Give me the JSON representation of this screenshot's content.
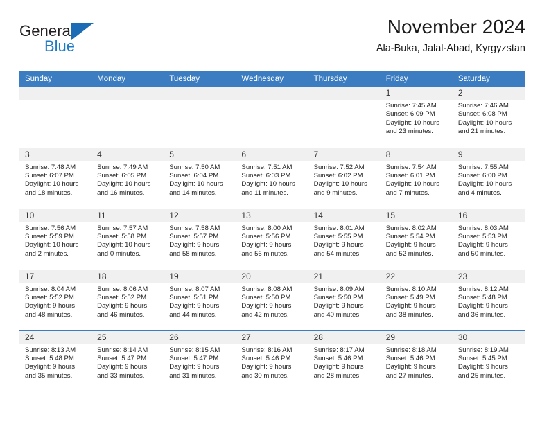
{
  "brand": {
    "name_part1": "General",
    "name_part2": "Blue",
    "logo_icon": "blue-triangle-logo",
    "accent_color": "#1b6cb5"
  },
  "header": {
    "month_title": "November 2024",
    "location": "Ala-Buka, Jalal-Abad, Kyrgyzstan"
  },
  "calendar": {
    "header_color": "#3b7dc0",
    "daynum_band_color": "#f0f0f0",
    "weekday_headers": [
      "Sunday",
      "Monday",
      "Tuesday",
      "Wednesday",
      "Thursday",
      "Friday",
      "Saturday"
    ],
    "weeks": [
      [
        {
          "day": "",
          "blank": true
        },
        {
          "day": "",
          "blank": true
        },
        {
          "day": "",
          "blank": true
        },
        {
          "day": "",
          "blank": true
        },
        {
          "day": "",
          "blank": true
        },
        {
          "day": "1",
          "sunrise": "Sunrise: 7:45 AM",
          "sunset": "Sunset: 6:09 PM",
          "daylight_line1": "Daylight: 10 hours",
          "daylight_line2": "and 23 minutes."
        },
        {
          "day": "2",
          "sunrise": "Sunrise: 7:46 AM",
          "sunset": "Sunset: 6:08 PM",
          "daylight_line1": "Daylight: 10 hours",
          "daylight_line2": "and 21 minutes."
        }
      ],
      [
        {
          "day": "3",
          "sunrise": "Sunrise: 7:48 AM",
          "sunset": "Sunset: 6:07 PM",
          "daylight_line1": "Daylight: 10 hours",
          "daylight_line2": "and 18 minutes."
        },
        {
          "day": "4",
          "sunrise": "Sunrise: 7:49 AM",
          "sunset": "Sunset: 6:05 PM",
          "daylight_line1": "Daylight: 10 hours",
          "daylight_line2": "and 16 minutes."
        },
        {
          "day": "5",
          "sunrise": "Sunrise: 7:50 AM",
          "sunset": "Sunset: 6:04 PM",
          "daylight_line1": "Daylight: 10 hours",
          "daylight_line2": "and 14 minutes."
        },
        {
          "day": "6",
          "sunrise": "Sunrise: 7:51 AM",
          "sunset": "Sunset: 6:03 PM",
          "daylight_line1": "Daylight: 10 hours",
          "daylight_line2": "and 11 minutes."
        },
        {
          "day": "7",
          "sunrise": "Sunrise: 7:52 AM",
          "sunset": "Sunset: 6:02 PM",
          "daylight_line1": "Daylight: 10 hours",
          "daylight_line2": "and 9 minutes."
        },
        {
          "day": "8",
          "sunrise": "Sunrise: 7:54 AM",
          "sunset": "Sunset: 6:01 PM",
          "daylight_line1": "Daylight: 10 hours",
          "daylight_line2": "and 7 minutes."
        },
        {
          "day": "9",
          "sunrise": "Sunrise: 7:55 AM",
          "sunset": "Sunset: 6:00 PM",
          "daylight_line1": "Daylight: 10 hours",
          "daylight_line2": "and 4 minutes."
        }
      ],
      [
        {
          "day": "10",
          "sunrise": "Sunrise: 7:56 AM",
          "sunset": "Sunset: 5:59 PM",
          "daylight_line1": "Daylight: 10 hours",
          "daylight_line2": "and 2 minutes."
        },
        {
          "day": "11",
          "sunrise": "Sunrise: 7:57 AM",
          "sunset": "Sunset: 5:58 PM",
          "daylight_line1": "Daylight: 10 hours",
          "daylight_line2": "and 0 minutes."
        },
        {
          "day": "12",
          "sunrise": "Sunrise: 7:58 AM",
          "sunset": "Sunset: 5:57 PM",
          "daylight_line1": "Daylight: 9 hours",
          "daylight_line2": "and 58 minutes."
        },
        {
          "day": "13",
          "sunrise": "Sunrise: 8:00 AM",
          "sunset": "Sunset: 5:56 PM",
          "daylight_line1": "Daylight: 9 hours",
          "daylight_line2": "and 56 minutes."
        },
        {
          "day": "14",
          "sunrise": "Sunrise: 8:01 AM",
          "sunset": "Sunset: 5:55 PM",
          "daylight_line1": "Daylight: 9 hours",
          "daylight_line2": "and 54 minutes."
        },
        {
          "day": "15",
          "sunrise": "Sunrise: 8:02 AM",
          "sunset": "Sunset: 5:54 PM",
          "daylight_line1": "Daylight: 9 hours",
          "daylight_line2": "and 52 minutes."
        },
        {
          "day": "16",
          "sunrise": "Sunrise: 8:03 AM",
          "sunset": "Sunset: 5:53 PM",
          "daylight_line1": "Daylight: 9 hours",
          "daylight_line2": "and 50 minutes."
        }
      ],
      [
        {
          "day": "17",
          "sunrise": "Sunrise: 8:04 AM",
          "sunset": "Sunset: 5:52 PM",
          "daylight_line1": "Daylight: 9 hours",
          "daylight_line2": "and 48 minutes."
        },
        {
          "day": "18",
          "sunrise": "Sunrise: 8:06 AM",
          "sunset": "Sunset: 5:52 PM",
          "daylight_line1": "Daylight: 9 hours",
          "daylight_line2": "and 46 minutes."
        },
        {
          "day": "19",
          "sunrise": "Sunrise: 8:07 AM",
          "sunset": "Sunset: 5:51 PM",
          "daylight_line1": "Daylight: 9 hours",
          "daylight_line2": "and 44 minutes."
        },
        {
          "day": "20",
          "sunrise": "Sunrise: 8:08 AM",
          "sunset": "Sunset: 5:50 PM",
          "daylight_line1": "Daylight: 9 hours",
          "daylight_line2": "and 42 minutes."
        },
        {
          "day": "21",
          "sunrise": "Sunrise: 8:09 AM",
          "sunset": "Sunset: 5:50 PM",
          "daylight_line1": "Daylight: 9 hours",
          "daylight_line2": "and 40 minutes."
        },
        {
          "day": "22",
          "sunrise": "Sunrise: 8:10 AM",
          "sunset": "Sunset: 5:49 PM",
          "daylight_line1": "Daylight: 9 hours",
          "daylight_line2": "and 38 minutes."
        },
        {
          "day": "23",
          "sunrise": "Sunrise: 8:12 AM",
          "sunset": "Sunset: 5:48 PM",
          "daylight_line1": "Daylight: 9 hours",
          "daylight_line2": "and 36 minutes."
        }
      ],
      [
        {
          "day": "24",
          "sunrise": "Sunrise: 8:13 AM",
          "sunset": "Sunset: 5:48 PM",
          "daylight_line1": "Daylight: 9 hours",
          "daylight_line2": "and 35 minutes."
        },
        {
          "day": "25",
          "sunrise": "Sunrise: 8:14 AM",
          "sunset": "Sunset: 5:47 PM",
          "daylight_line1": "Daylight: 9 hours",
          "daylight_line2": "and 33 minutes."
        },
        {
          "day": "26",
          "sunrise": "Sunrise: 8:15 AM",
          "sunset": "Sunset: 5:47 PM",
          "daylight_line1": "Daylight: 9 hours",
          "daylight_line2": "and 31 minutes."
        },
        {
          "day": "27",
          "sunrise": "Sunrise: 8:16 AM",
          "sunset": "Sunset: 5:46 PM",
          "daylight_line1": "Daylight: 9 hours",
          "daylight_line2": "and 30 minutes."
        },
        {
          "day": "28",
          "sunrise": "Sunrise: 8:17 AM",
          "sunset": "Sunset: 5:46 PM",
          "daylight_line1": "Daylight: 9 hours",
          "daylight_line2": "and 28 minutes."
        },
        {
          "day": "29",
          "sunrise": "Sunrise: 8:18 AM",
          "sunset": "Sunset: 5:46 PM",
          "daylight_line1": "Daylight: 9 hours",
          "daylight_line2": "and 27 minutes."
        },
        {
          "day": "30",
          "sunrise": "Sunrise: 8:19 AM",
          "sunset": "Sunset: 5:45 PM",
          "daylight_line1": "Daylight: 9 hours",
          "daylight_line2": "and 25 minutes."
        }
      ]
    ]
  }
}
